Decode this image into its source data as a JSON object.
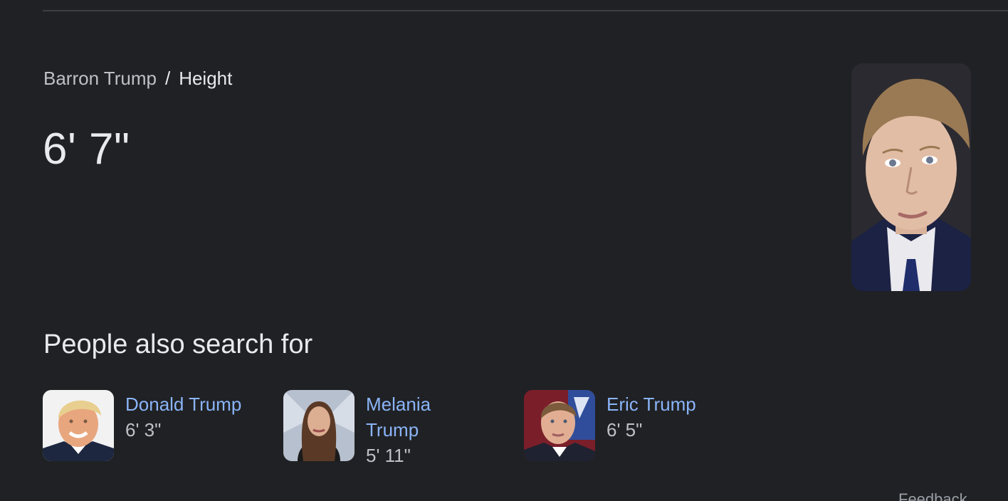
{
  "breadcrumb": {
    "entity": "Barron Trump",
    "separator": "/",
    "attribute": "Height"
  },
  "answer": "6' 7\"",
  "portrait": {
    "icon": "person-portrait-image"
  },
  "people_also_search": {
    "title": "People also search for",
    "items": [
      {
        "name": "Donald Trump",
        "value": "6' 3\""
      },
      {
        "name": "Melania Trump",
        "value": "5' 11\""
      },
      {
        "name": "Eric Trump",
        "value": "6' 5\""
      }
    ]
  },
  "feedback_label": "Feedback",
  "colors": {
    "background": "#202124",
    "link": "#8ab4f8",
    "text": "#e8eaed",
    "muted": "#bdc1c6"
  }
}
